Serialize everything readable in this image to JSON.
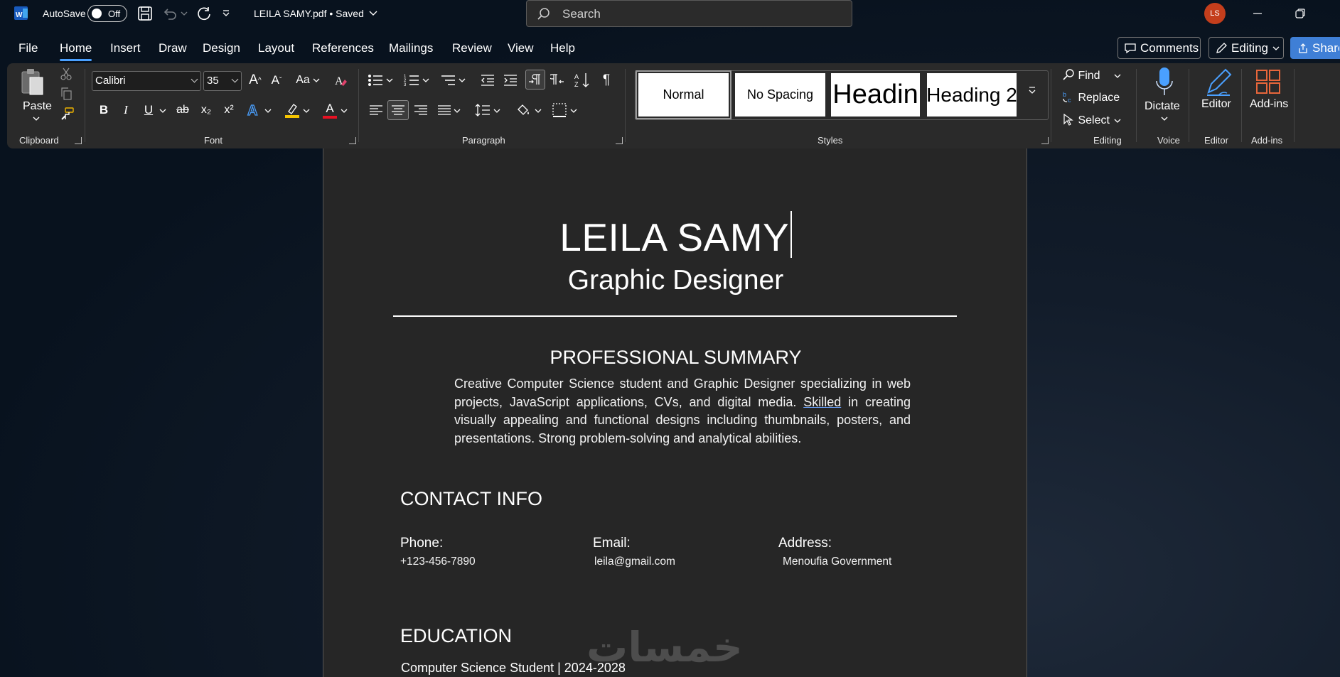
{
  "titlebar": {
    "app_icon": "word-icon",
    "autosave_label": "AutoSave",
    "autosave_state": "Off",
    "file_title": "LEILA SAMY.pdf",
    "save_status": "Saved",
    "search_placeholder": "Search",
    "user_initials": "LS"
  },
  "menu": {
    "tabs": [
      "File",
      "Home",
      "Insert",
      "Draw",
      "Design",
      "Layout",
      "References",
      "Mailings",
      "Review",
      "View",
      "Help"
    ],
    "active_tab": "Home",
    "comments_label": "Comments",
    "editing_label": "Editing",
    "share_label": "Share"
  },
  "ribbon": {
    "clipboard": {
      "paste_label": "Paste",
      "group_label": "Clipboard"
    },
    "font": {
      "family": "Calibri",
      "size": "35",
      "case_label": "Aa",
      "group_label": "Font",
      "bold": "B",
      "italic": "I",
      "underline": "U",
      "strike": "ab",
      "subscript": "x₂",
      "superscript": "x²",
      "font_color_label": "A"
    },
    "paragraph": {
      "group_label": "Paragraph"
    },
    "styles": {
      "items": [
        "Normal",
        "No Spacing",
        "Headin",
        "Heading 2"
      ],
      "group_label": "Styles"
    },
    "editing": {
      "find": "Find",
      "replace": "Replace",
      "select": "Select",
      "group_label": "Editing"
    },
    "voice": {
      "dictate": "Dictate",
      "group_label": "Voice"
    },
    "editor": {
      "label": "Editor",
      "group_label": "Editor"
    },
    "addins": {
      "label": "Add-ins",
      "group_label": "Add-ins"
    }
  },
  "document": {
    "name": "LEILA SAMY",
    "role": "Graphic Designer",
    "summary_title": "PROFESSIONAL SUMMARY",
    "summary_before": "Creative Computer Science student and Graphic Designer specializing in web projects, JavaScript applications, CVs, and digital media. ",
    "summary_link": "Skilled",
    "summary_after": " in creating visually appealing and functional designs including thumbnails, posters, and presentations. Strong problem-solving and analytical abilities.",
    "contact_title": "CONTACT INFO",
    "contacts": [
      {
        "label": "Phone:",
        "value": "+123-456-7890"
      },
      {
        "label": "Email:",
        "value": "leila@gmail.com"
      },
      {
        "label": "Address:",
        "value": "Menoufia Government"
      }
    ],
    "education_title": "EDUCATION",
    "education_line": "Computer Science Student | 2024-2028"
  },
  "watermark": "خمسات",
  "colors": {
    "accent": "#4aa0ff",
    "share": "#3f7fd6",
    "avatar": "#c43e1c",
    "highlight": "#f5c400",
    "font_red": "#e81123",
    "ribbon_bg": "#2a2a2a",
    "page_bg": "#262626"
  }
}
